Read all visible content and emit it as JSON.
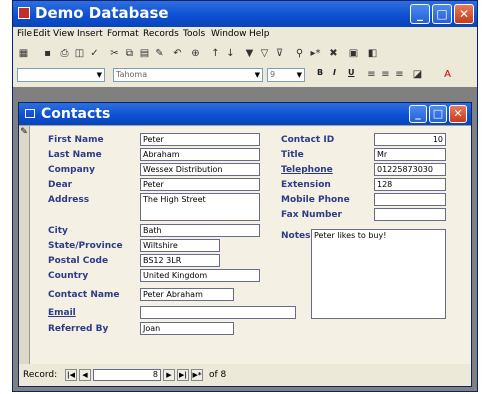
{
  "app": {
    "title": "Demo Database"
  },
  "menu": [
    "File",
    "Edit",
    "View",
    "Insert",
    "Format",
    "Records",
    "Tools",
    "Window",
    "Help"
  ],
  "format_toolbar": {
    "font": "Tahoma",
    "size": "9",
    "bold": "B",
    "italic": "I",
    "underline": "U"
  },
  "form": {
    "title": "Contacts",
    "left_fields": [
      {
        "label": "First Name",
        "value": "Peter"
      },
      {
        "label": "Last Name",
        "value": "Abraham"
      },
      {
        "label": "Company",
        "value": "Wessex Distribution"
      },
      {
        "label": "Dear",
        "value": "Peter"
      },
      {
        "label": "Address",
        "value": "The High Street"
      },
      {
        "label": "City",
        "value": "Bath"
      },
      {
        "label": "State/Province",
        "value": "Wiltshire"
      },
      {
        "label": "Postal Code",
        "value": "BS12 3LR"
      },
      {
        "label": "Country",
        "value": "United Kingdom"
      },
      {
        "label": "Contact Name",
        "value": "Peter Abraham"
      },
      {
        "label": "Email",
        "value": ""
      },
      {
        "label": "Referred By",
        "value": "Joan"
      }
    ],
    "right_fields": [
      {
        "label": "Contact ID",
        "value": "10"
      },
      {
        "label": "Title",
        "value": "Mr"
      },
      {
        "label": "Telephone",
        "value": "01225873030"
      },
      {
        "label": "Extension",
        "value": "128"
      },
      {
        "label": "Mobile Phone",
        "value": ""
      },
      {
        "label": "Fax Number",
        "value": ""
      }
    ],
    "notes": {
      "label": "Notes",
      "value": "Peter likes to buy!"
    }
  },
  "navigation": {
    "label": "Record:",
    "current": "8",
    "of_text": "of 8"
  }
}
